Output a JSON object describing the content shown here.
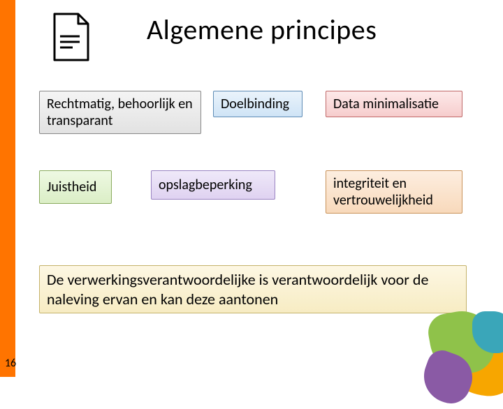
{
  "title": "Algemene principes",
  "principles": {
    "row1": {
      "a": "Rechtmatig, behoorlijk en transparant",
      "b": "Doelbinding",
      "c": "Data minimalisatie"
    },
    "row2": {
      "a": "Juistheid",
      "b": "opslagbeperking",
      "c": "integriteit en vertrouwelijkheid"
    }
  },
  "footer": "De verwerkingsverantwoordelijke is verantwoordelijk voor de naleving ervan en kan deze aantonen",
  "page_number": "16",
  "accent_color": "#ff7400"
}
